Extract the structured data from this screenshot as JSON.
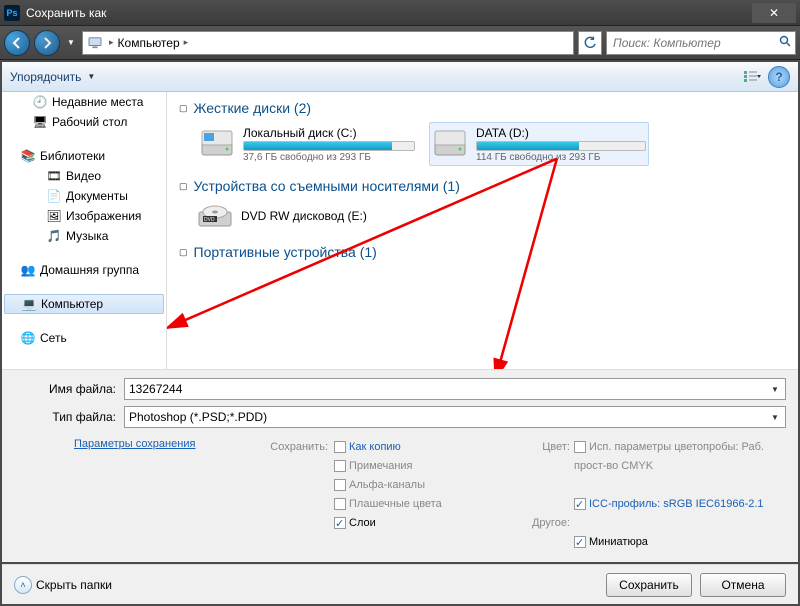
{
  "title": "Сохранить как",
  "nav": {
    "breadcrumb_root": "Компьютер",
    "search_placeholder": "Поиск: Компьютер"
  },
  "toolbar": {
    "organize": "Упорядочить"
  },
  "sidebar": {
    "recent": "Недавние места",
    "desktop": "Рабочий стол",
    "libraries": "Библиотеки",
    "video": "Видео",
    "documents": "Документы",
    "images": "Изображения",
    "music": "Музыка",
    "homegroup": "Домашняя группа",
    "computer": "Компьютер",
    "network": "Сеть"
  },
  "content": {
    "section_hdd": "Жесткие диски (2)",
    "drives": [
      {
        "name": "Локальный диск (C:)",
        "free": "37,6 ГБ свободно из 293 ГБ",
        "fill_pct": 87
      },
      {
        "name": "DATA (D:)",
        "free": "114 ГБ свободно из 293 ГБ",
        "fill_pct": 61
      }
    ],
    "section_removable": "Устройства со съемными носителями (1)",
    "dvd": "DVD RW дисковод (E:)",
    "section_portable": "Портативные устройства (1)"
  },
  "fields": {
    "filename_label": "Имя файла:",
    "filename_value": "13267244",
    "filetype_label": "Тип файла:",
    "filetype_value": "Photoshop (*.PSD;*.PDD)"
  },
  "options": {
    "params_link": "Параметры сохранения",
    "save_label": "Сохранить:",
    "as_copy": "Как копию",
    "notes": "Примечания",
    "alpha": "Альфа-каналы",
    "spot": "Плашечные цвета",
    "layers": "Слои",
    "color_label": "Цвет:",
    "proof": "Исп. параметры цветопробы: Раб. прост-во CMYK",
    "icc": "ICC-профиль: sRGB IEC61966-2.1",
    "other_label": "Другое:",
    "thumbnail": "Миниатюра"
  },
  "footer": {
    "hide_folders": "Скрыть папки",
    "save": "Сохранить",
    "cancel": "Отмена"
  }
}
